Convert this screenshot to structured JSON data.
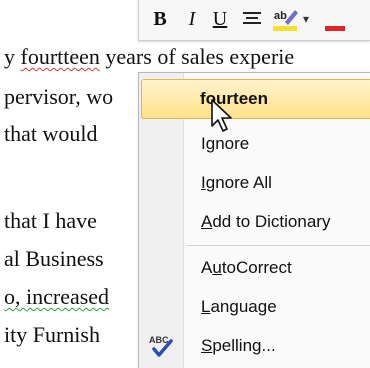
{
  "document": {
    "lines": [
      {
        "pre": "y ",
        "squiggle": "fourtteen",
        "post": " years of sales experie"
      },
      {
        "text": "pervisor, wo"
      },
      {
        "text": " that would"
      },
      {
        "text": ""
      },
      {
        "text": "that I have"
      },
      {
        "text": "al Business"
      },
      {
        "squiggle_green": "o, increased"
      },
      {
        "text": "ity Furnish"
      }
    ]
  },
  "toolbar": {
    "bold": "B",
    "italic": "I",
    "underline": "U",
    "align": "≡",
    "highlight": "ab",
    "dropdown": "▾",
    "colors": {
      "highlight": "#f5e12b",
      "font_color": "#e02424"
    }
  },
  "context_menu": {
    "suggestion": "fourteen",
    "items": [
      {
        "label": "Ignore",
        "underline_index": 1
      },
      {
        "label": "Ignore All",
        "underline_index": 0
      },
      {
        "label": "Add to Dictionary",
        "underline_index": 0
      },
      {
        "label": "AutoCorrect",
        "underline_index": 1
      },
      {
        "label": "Language",
        "underline_index": 0
      },
      {
        "label": "Spelling...",
        "underline_index": 0
      }
    ],
    "spelling_icon_text": "ABC"
  }
}
